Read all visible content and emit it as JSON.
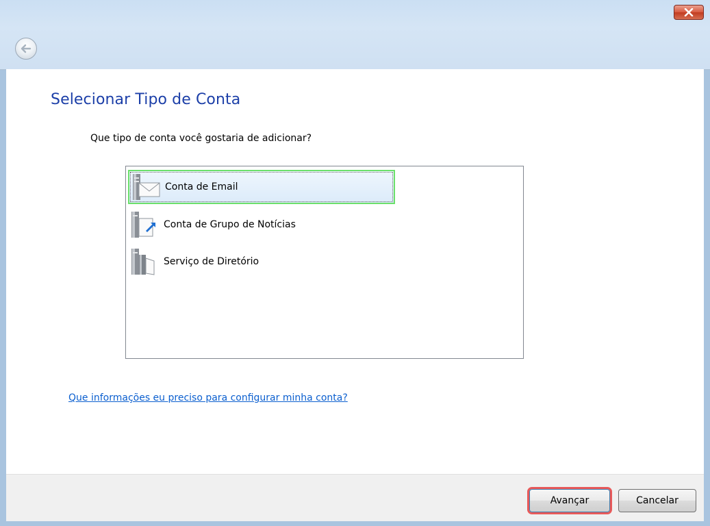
{
  "window": {
    "close_icon": "close-icon",
    "back_icon": "back-arrow-icon"
  },
  "page": {
    "title": "Selecionar Tipo de Conta",
    "question": "Que tipo de conta você gostaria de adicionar?",
    "help_link": "Que informações eu preciso para configurar minha conta?"
  },
  "account_types": [
    {
      "label": "Conta de Email",
      "icon": "email-account-icon",
      "selected": true
    },
    {
      "label": "Conta de Grupo de Notícias",
      "icon": "newsgroup-account-icon",
      "selected": false
    },
    {
      "label": "Serviço de Diretório",
      "icon": "directory-service-icon",
      "selected": false
    }
  ],
  "footer": {
    "next_label": "Avançar",
    "cancel_label": "Cancelar"
  },
  "colors": {
    "title_blue": "#1c3fa8",
    "link_blue": "#0b5fcf",
    "selection_highlight": "#6be06b",
    "primary_button_highlight": "#e85a5a"
  }
}
